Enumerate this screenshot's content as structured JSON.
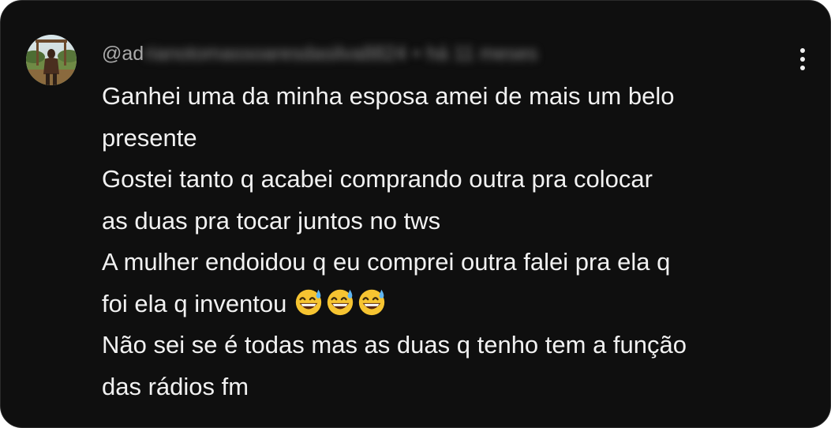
{
  "comment": {
    "author_visible": "@ad",
    "author_blurred": "rianotomassoaresdasilva8824",
    "separator": "•",
    "timestamp": "há 11 meses",
    "lines": [
      "Ganhei uma da minha esposa amei de mais um belo",
      "presente",
      "Gostei tanto q acabei comprando outra pra colocar",
      "as duas pra tocar juntos no tws",
      "A mulher endoidou q eu comprei outra falei pra ela q",
      "foi ela q inventou",
      "Não sei se é todas mas as duas q tenho tem a função",
      "das rádios fm"
    ],
    "emoji_icons": [
      "grinning-face-with-sweat-icon",
      "grinning-face-with-sweat-icon",
      "grinning-face-with-sweat-icon"
    ],
    "menu_icon": "vertical-ellipsis-icon"
  },
  "colors": {
    "background": "#0f0f0f",
    "text": "#f1f1f1",
    "meta": "#aaaaaa"
  }
}
